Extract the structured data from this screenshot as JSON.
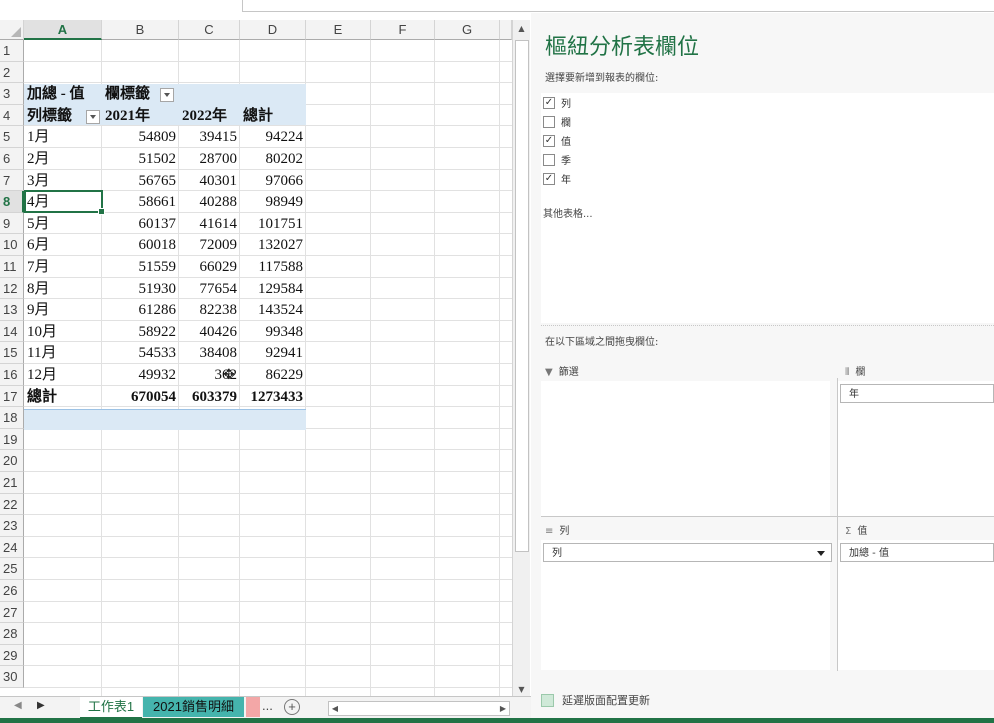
{
  "columns": [
    "A",
    "B",
    "C",
    "D",
    "E",
    "F",
    "G"
  ],
  "rows": [
    "1",
    "2",
    "3",
    "4",
    "5",
    "6",
    "7",
    "8",
    "9",
    "10",
    "11",
    "12",
    "13",
    "14",
    "15",
    "16",
    "17",
    "18",
    "19",
    "20",
    "21",
    "22",
    "23",
    "24",
    "25",
    "26",
    "27",
    "28",
    "29",
    "30"
  ],
  "pivot": {
    "value_label": "加總 - 值",
    "col_label": "欄標籤",
    "row_label": "列標籤",
    "headers": [
      "2021年",
      "2022年",
      "總計"
    ],
    "data": [
      {
        "month": "1月",
        "y2021": "54809",
        "y2022": "39415",
        "total": "94224"
      },
      {
        "month": "2月",
        "y2021": "51502",
        "y2022": "28700",
        "total": "80202"
      },
      {
        "month": "3月",
        "y2021": "56765",
        "y2022": "40301",
        "total": "97066"
      },
      {
        "month": "4月",
        "y2021": "58661",
        "y2022": "40288",
        "total": "98949"
      },
      {
        "month": "5月",
        "y2021": "60137",
        "y2022": "41614",
        "total": "101751"
      },
      {
        "month": "6月",
        "y2021": "60018",
        "y2022": "72009",
        "total": "132027"
      },
      {
        "month": "7月",
        "y2021": "51559",
        "y2022": "66029",
        "total": "117588"
      },
      {
        "month": "8月",
        "y2021": "51930",
        "y2022": "77654",
        "total": "129584"
      },
      {
        "month": "9月",
        "y2021": "61286",
        "y2022": "82238",
        "total": "143524"
      },
      {
        "month": "10月",
        "y2021": "58922",
        "y2022": "40426",
        "total": "99348"
      },
      {
        "month": "11月",
        "y2021": "54533",
        "y2022": "38408",
        "total": "92941"
      },
      {
        "month": "12月",
        "y2021": "49932",
        "y2022": "362",
        "total": "86229"
      }
    ],
    "grand_label": "總計",
    "grand": {
      "y2021": "670054",
      "y2022": "603379",
      "total": "1273433"
    }
  },
  "selected_cell": "A8",
  "sheet_tabs": {
    "tab1": "工作表1",
    "tab2": "2021銷售明細",
    "more": "..."
  },
  "panel": {
    "title": "樞紐分析表欄位",
    "subtitle": "選擇要新增到報表的欄位:",
    "fields": [
      {
        "label": "列",
        "checked": true
      },
      {
        "label": "欄",
        "checked": false
      },
      {
        "label": "值",
        "checked": true
      },
      {
        "label": "季",
        "checked": false
      },
      {
        "label": "年",
        "checked": true
      }
    ],
    "more_tables": "其他表格...",
    "drag_tip": "在以下區域之間拖曳欄位:",
    "areas": {
      "filters": {
        "label": "篩選",
        "icon": "filter-icon"
      },
      "columns": {
        "label": "欄",
        "icon": "columns-icon",
        "item": "年"
      },
      "rows": {
        "label": "列",
        "icon": "rows-icon",
        "item": "列"
      },
      "values": {
        "label": "值",
        "icon": "sigma-icon",
        "item": "加總 - 值"
      }
    },
    "defer_update": "延遲版面配置更新"
  }
}
